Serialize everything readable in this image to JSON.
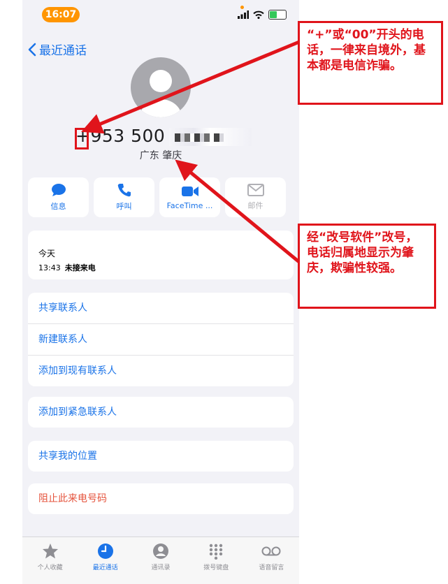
{
  "status_bar": {
    "time": "16:07"
  },
  "nav": {
    "back_label": "最近通话"
  },
  "contact": {
    "number_visible": "+953 500",
    "location": "广东 肇庆"
  },
  "actions": [
    {
      "label": "信息",
      "icon": "message-bubble-icon"
    },
    {
      "label": "呼叫",
      "icon": "phone-icon"
    },
    {
      "label": "FaceTime ...",
      "icon": "video-camera-icon"
    },
    {
      "label": "邮件",
      "icon": "mail-icon"
    }
  ],
  "recent": {
    "date": "今天",
    "time": "13:43",
    "status": "未接来电"
  },
  "contact_actions": [
    "共享联系人",
    "新建联系人",
    "添加到现有联系人"
  ],
  "emergency": "添加到紧急联系人",
  "share_location": "共享我的位置",
  "block": "阻止此来电号码",
  "tabs": [
    {
      "label": "个人收藏",
      "icon": "star-icon",
      "active": false
    },
    {
      "label": "最近通话",
      "icon": "clock-icon",
      "active": true
    },
    {
      "label": "通讯录",
      "icon": "person-circle-icon",
      "active": false
    },
    {
      "label": "拨号键盘",
      "icon": "keypad-icon",
      "active": false
    },
    {
      "label": "语音留言",
      "icon": "voicemail-icon",
      "active": false
    }
  ],
  "annotations": {
    "note1": "“+”或“00”开头的电话，一律来自境外，基本都是电信诈骗。",
    "note2": "经“改号软件”改号，电话归属地显示为肇庆，欺骗性较强。"
  },
  "colors": {
    "accent": "#1a73e8",
    "annotation": "#e0141b",
    "status_pill": "#ff9500",
    "danger": "#e5533c"
  }
}
